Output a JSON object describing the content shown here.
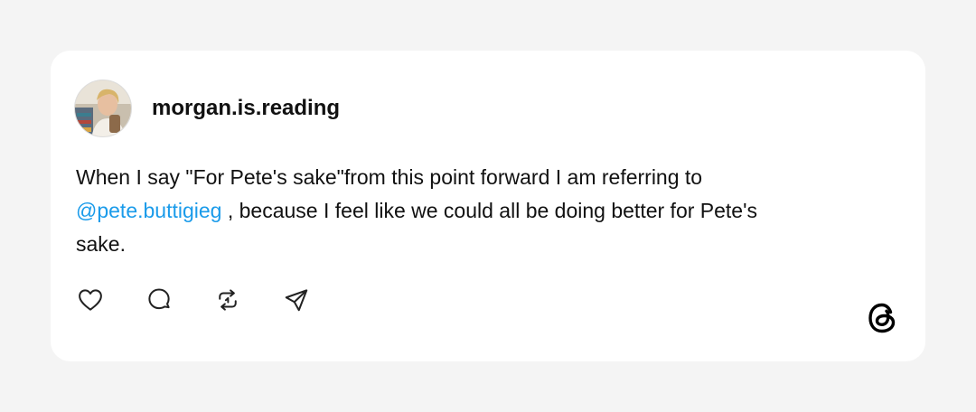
{
  "post": {
    "username": "morgan.is.reading",
    "text_before_mention": "When I say \"For Pete's sake\"from this point forward I am referring to",
    "mention": "@pete.buttigieg",
    "text_after_mention": " , because I feel like we could all be doing better for Pete's sake."
  },
  "colors": {
    "mention": "#1a9bea",
    "background": "#f4f4f4",
    "card": "#ffffff"
  },
  "icons": {
    "like": "heart-icon",
    "reply": "comment-icon",
    "repost": "repost-icon",
    "share": "send-icon",
    "brand": "threads-logo"
  }
}
